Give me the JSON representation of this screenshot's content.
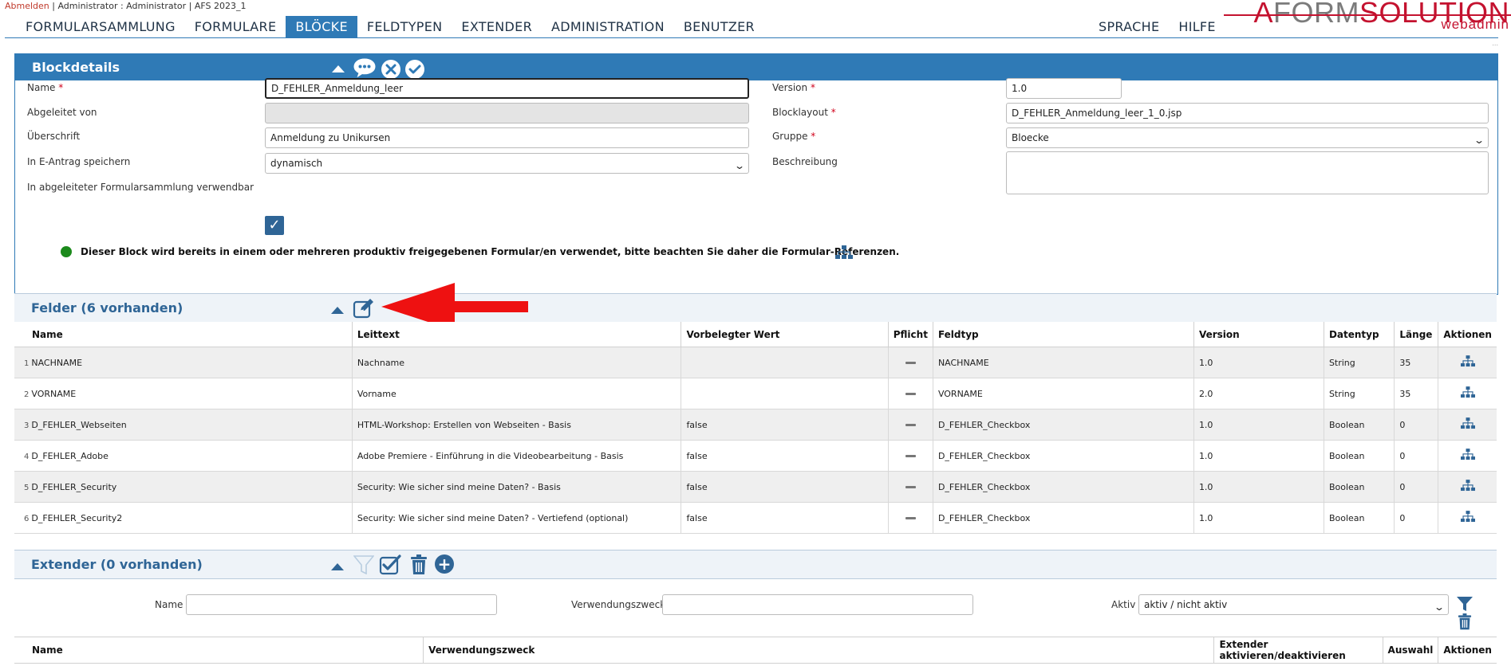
{
  "topline": {
    "logout": "Abmelden",
    "user": " | Administrator : Administrator | AFS 2023_1"
  },
  "nav": {
    "left": [
      "FORMULARSAMMLUNG",
      "FORMULARE",
      "BLÖCKE",
      "FELDTYPEN",
      "EXTENDER",
      "ADMINISTRATION",
      "BENUTZER"
    ],
    "active": "BLÖCKE",
    "right": [
      "SPRACHE",
      "HILFE"
    ]
  },
  "logo": {
    "part1": "A",
    "part2": "FORM",
    "part3": "SOLUTION",
    "sub": "webadmin"
  },
  "dots": "...",
  "blockdetails": {
    "title": "Blockdetails",
    "fields": {
      "name_label": "Name",
      "name_value": "D_FEHLER_Anmeldung_leer",
      "derived_label": "Abgeleitet von",
      "derived_value": "",
      "heading_label": "Überschrift",
      "heading_value": "Anmeldung zu Unikursen",
      "eantrag_label": "In E-Antrag speichern",
      "eantrag_value": "dynamisch",
      "usable_label": "In abgeleiteter Formularsammlung verwendbar",
      "usable_checked": true,
      "version_label": "Version",
      "version_value": "1.0",
      "layout_label": "Blocklayout",
      "layout_value": "D_FEHLER_Anmeldung_leer_1_0.jsp",
      "group_label": "Gruppe",
      "group_value": "Bloecke",
      "desc_label": "Beschreibung",
      "desc_value": ""
    },
    "required_mark": "*",
    "notice": "Dieser Block wird bereits in einem oder mehreren produktiv freigegebenen Formular/en verwendet, bitte beachten Sie daher die Formular-Referenzen."
  },
  "felder": {
    "title": "Felder (6 vorhanden)",
    "columns": [
      "Name",
      "Leittext",
      "Vorbelegter Wert",
      "Pflicht",
      "Feldtyp",
      "Version",
      "Datentyp",
      "Länge",
      "Aktionen"
    ],
    "rows": [
      {
        "num": "1",
        "name": "NACHNAME",
        "leittext": "Nachname",
        "wert": "",
        "feldtyp": "NACHNAME",
        "version": "1.0",
        "datentyp": "String",
        "laenge": "35"
      },
      {
        "num": "2",
        "name": "VORNAME",
        "leittext": "Vorname",
        "wert": "",
        "feldtyp": "VORNAME",
        "version": "2.0",
        "datentyp": "String",
        "laenge": "35"
      },
      {
        "num": "3",
        "name": "D_FEHLER_Webseiten",
        "leittext": "HTML-Workshop: Erstellen von Webseiten - Basis",
        "wert": "false",
        "feldtyp": "D_FEHLER_Checkbox",
        "version": "1.0",
        "datentyp": "Boolean",
        "laenge": "0"
      },
      {
        "num": "4",
        "name": "D_FEHLER_Adobe",
        "leittext": "Adobe Premiere - Einführung in die Videobearbeitung - Basis",
        "wert": "false",
        "feldtyp": "D_FEHLER_Checkbox",
        "version": "1.0",
        "datentyp": "Boolean",
        "laenge": "0"
      },
      {
        "num": "5",
        "name": "D_FEHLER_Security",
        "leittext": "Security: Wie sicher sind meine Daten? - Basis",
        "wert": "false",
        "feldtyp": "D_FEHLER_Checkbox",
        "version": "1.0",
        "datentyp": "Boolean",
        "laenge": "0"
      },
      {
        "num": "6",
        "name": "D_FEHLER_Security2",
        "leittext": "Security: Wie sicher sind meine Daten? - Vertiefend (optional)",
        "wert": "false",
        "feldtyp": "D_FEHLER_Checkbox",
        "version": "1.0",
        "datentyp": "Boolean",
        "laenge": "0"
      }
    ]
  },
  "extender": {
    "title": "Extender (0 vorhanden)",
    "filter_name_label": "Name",
    "filter_name_value": "",
    "filter_purpose_label": "Verwendungszweck",
    "filter_purpose_value": "",
    "filter_active_label": "Aktiv",
    "filter_active_value": "aktiv / nicht aktiv",
    "columns": [
      "Name",
      "Verwendungszweck",
      "Extender aktivieren/deaktivieren",
      "Auswahl",
      "Aktionen"
    ]
  },
  "colors": {
    "primary": "#2f7ab6",
    "brand_red": "#c4122f",
    "arrow_red": "#ee1111",
    "ok_green": "#1c8a1c"
  }
}
